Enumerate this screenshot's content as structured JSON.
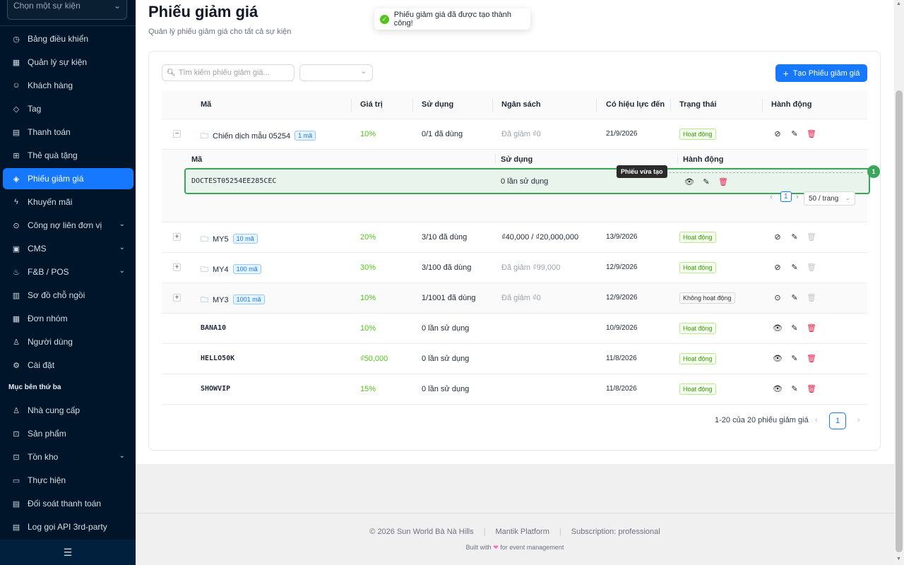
{
  "sidebar": {
    "event_select_placeholder": "Chọn một sự kiện",
    "items": [
      {
        "label": "Bảng điều khiển",
        "icon": "dashboard-icon"
      },
      {
        "label": "Quản lý sự kiện",
        "icon": "calendar-icon"
      },
      {
        "label": "Khách hàng",
        "icon": "users-icon"
      },
      {
        "label": "Tag",
        "icon": "tag-icon"
      },
      {
        "label": "Thanh toán",
        "icon": "payment-icon"
      },
      {
        "label": "Thẻ quà tặng",
        "icon": "gift-icon"
      },
      {
        "label": "Phiếu giảm giá",
        "icon": "coupon-icon",
        "active": true
      },
      {
        "label": "Khuyến mãi",
        "icon": "promotion-icon"
      },
      {
        "label": "Công nợ liên đơn vị",
        "icon": "debt-icon",
        "submenu": true
      },
      {
        "label": "CMS",
        "icon": "cms-icon",
        "submenu": true
      },
      {
        "label": "F&B / POS",
        "icon": "food-icon",
        "submenu": true
      },
      {
        "label": "Sơ đồ chỗ ngồi",
        "icon": "seat-map-icon"
      },
      {
        "label": "Đơn nhóm",
        "icon": "group-order-icon"
      },
      {
        "label": "Người dùng",
        "icon": "user-icon"
      },
      {
        "label": "Cài đặt",
        "icon": "settings-icon"
      }
    ],
    "group_label": "Mục bên thứ ba",
    "third_party_items": [
      {
        "label": "Nhà cung cấp",
        "icon": "supplier-icon"
      },
      {
        "label": "Sản phẩm",
        "icon": "product-icon"
      },
      {
        "label": "Tồn kho",
        "icon": "inventory-icon",
        "submenu": true
      },
      {
        "label": "Thực hiện",
        "icon": "fulfillment-icon"
      },
      {
        "label": "Đối soát thanh toán",
        "icon": "reconcile-icon"
      },
      {
        "label": "Log gọi API 3rd-party",
        "icon": "api-log-icon"
      }
    ]
  },
  "header": {
    "title": "Phiếu giảm giá",
    "subtitle": "Quản lý phiếu giảm giá cho tất cả sự kiện"
  },
  "toast": {
    "message": "Phiếu giảm giá đã được tạo thành công!"
  },
  "toolbar": {
    "search_placeholder": "Tìm kiếm phiếu giảm giá...",
    "create_label": "Tạo Phiếu giảm giá"
  },
  "table": {
    "columns": [
      "Mã",
      "Giá trị",
      "Sử dụng",
      "Ngân sách",
      "Có hiệu lực đến",
      "Trạng thái",
      "Hành động"
    ],
    "rows": [
      {
        "code": "Chiến dịch mẫu 05254",
        "count": "1 mã",
        "value": "10%",
        "usage": "0/1 đã dùng",
        "budget": "Đã giảm ₫0",
        "valid_until": "21/9/2026",
        "status": "Hoạt động",
        "expander": "−",
        "group": true
      },
      {
        "code": "MY5",
        "count": "10 mã",
        "value": "20%",
        "usage": "3/10 đã dùng",
        "budget": "₫40,000 / ₫20,000,000",
        "valid_until": "13/9/2026",
        "status": "Hoạt động",
        "expander": "+",
        "group": true
      },
      {
        "code": "MY4",
        "count": "100 mã",
        "value": "30%",
        "usage": "3/100 đã dùng",
        "budget": "Đã giảm ₫99,000",
        "valid_until": "12/9/2026",
        "status": "Hoạt động",
        "expander": "+",
        "group": true
      },
      {
        "code": "MY3",
        "count": "1001 mã",
        "value": "10%",
        "usage": "1/1001 đã dùng",
        "budget": "Đã giảm ₫0",
        "valid_until": "12/9/2026",
        "status": "Không hoạt động",
        "expander": "+",
        "group": true
      },
      {
        "code": "BANA10",
        "value": "10%",
        "usage": "0 lần sử dụng",
        "budget": "",
        "valid_until": "10/9/2026",
        "status": "Hoạt động"
      },
      {
        "code": "HELLO50K",
        "value": "₫50,000",
        "usage": "0 lần sử dụng",
        "budget": "",
        "valid_until": "11/8/2026",
        "status": "Hoạt động"
      },
      {
        "code": "SHOWVIP",
        "value": "15%",
        "usage": "0 lần sử dụng",
        "budget": "",
        "valid_until": "11/8/2026",
        "status": "Hoạt động"
      }
    ]
  },
  "expanded": {
    "columns": [
      "Mã",
      "Sử dụng",
      "Hành động"
    ],
    "code": "DOCTEST05254EE285CEC",
    "usage": "0 lần sử dụng",
    "tooltip": "Phiếu vừa tạo",
    "badge": "1",
    "current_page": "1",
    "page_size": "50 / trang"
  },
  "pagination": {
    "summary": "1-20 của 20 phiếu giảm giá",
    "current_page": "1"
  },
  "footer": {
    "copyright": "© 2026 Sun World Bà Nà Hills",
    "platform": "Mantik Platform",
    "subscription": "Subscription: professional",
    "built_prefix": "Built with",
    "built_suffix": "for event management"
  },
  "colors": {
    "primary": "#1677ff",
    "sidebar_bg": "#001529",
    "success": "#52c41a",
    "danger": "#e11d48",
    "highlight_border": "#3aa55b"
  }
}
